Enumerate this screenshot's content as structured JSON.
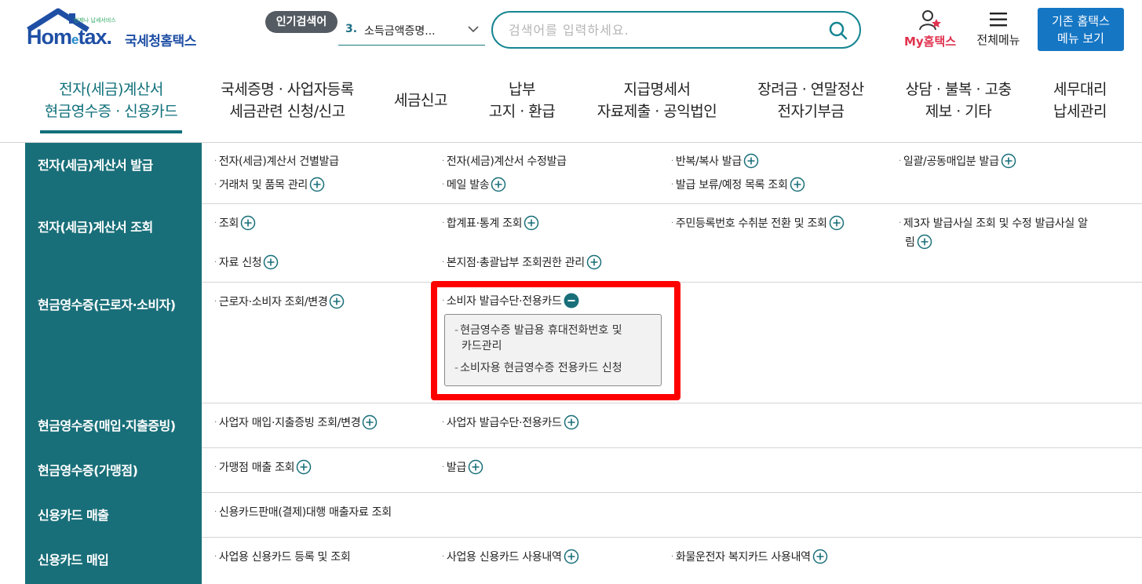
{
  "header": {
    "logo": {
      "tagline": "언제나 납세서비스",
      "wordmark_a": "Hom",
      "wordmark_e": "e",
      "wordmark_b": "tax.",
      "kor_name": "국세청홈택스"
    },
    "popular_badge": "인기검색어",
    "popular_number": "3.",
    "popular_term": "소득금액증명...",
    "search_placeholder": "검색어를 입력하세요.",
    "my_hometax": "My홈택스",
    "all_menu": "전체메뉴",
    "old_menu_line1": "기존 홈택스",
    "old_menu_line2": "메뉴 보기"
  },
  "nav": [
    {
      "line1": "전자(세금)계산서",
      "line2": "현금영수증 · 신용카드"
    },
    {
      "line1": "국세증명 · 사업자등록",
      "line2": "세금관련 신청/신고"
    },
    {
      "line1": "세금신고",
      "line2": ""
    },
    {
      "line1": "납부",
      "line2": "고지 · 환급"
    },
    {
      "line1": "지급명세서",
      "line2": "자료제출 · 공익법인"
    },
    {
      "line1": "장려금 · 연말정산",
      "line2": "전자기부금"
    },
    {
      "line1": "상담 · 불복 · 고충",
      "line2": "제보 · 기타"
    },
    {
      "line1": "세무대리",
      "line2": "납세관리"
    }
  ],
  "rows": [
    {
      "title": "전자(세금)계산서 발급",
      "items": [
        "전자(세금)계산서 건별발급",
        "전자(세금)계산서 수정발급",
        "반복/복사 발급",
        "일괄/공동매입분 발급",
        "거래처 및 품목 관리",
        "메일 발송",
        "발급 보류/예정 목록 조회"
      ]
    },
    {
      "title": "전자(세금)계산서 조회",
      "items": [
        "조회",
        "합계표·통계 조회",
        "주민등록번호 수취분 전환 및 조회",
        "제3자 발급사실 조회 및 수정 발급사실 알",
        "림",
        "자료 신청",
        "본지점·총괄납부 조회권한 관리"
      ]
    },
    {
      "title": "현금영수증(근로자·소비자)",
      "items": [
        "근로자·소비자 조회/변경",
        "소비자 발급수단·전용카드"
      ],
      "submenu": [
        "현금영수증 발급용 휴대전화번호 및",
        "카드관리",
        "소비자용 현금영수증 전용카드 신청"
      ]
    },
    {
      "title": "현금영수증(매입·지출증빙)",
      "items": [
        "사업자 매입·지출증빙 조회/변경",
        "사업자 발급수단·전용카드"
      ]
    },
    {
      "title": "현금영수증(가맹점)",
      "items": [
        "가맹점 매출 조회",
        "발급"
      ]
    },
    {
      "title": "신용카드 매출",
      "items": [
        "신용카드판매(결제)대행 매출자료 조회"
      ]
    },
    {
      "title": "신용카드 매입",
      "items": [
        "사업용 신용카드 등록 및 조회",
        "사업용 신용카드 사용내역",
        "화물운전자 복지카드 사용내역"
      ]
    }
  ],
  "colors": {
    "teal": "#196f79",
    "accent_blue": "#1576c4",
    "highlight_red": "#ff0000",
    "my_pink": "#e0334f"
  }
}
